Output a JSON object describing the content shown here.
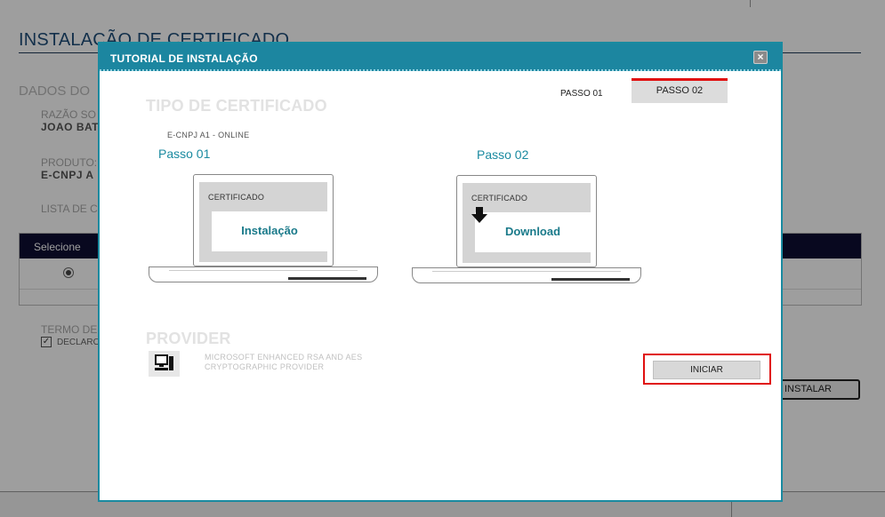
{
  "background": {
    "page_title": "INSTALAÇÃO DE  CERTIFICADO",
    "section_title": "DADOS DO",
    "fields": [
      {
        "label": "RAZÃO SO",
        "value": "JOAO BAT"
      },
      {
        "label": "PRODUTO:",
        "value": "E-CNPJ A"
      },
      {
        "label": "LISTA DE C",
        "value": ""
      }
    ],
    "table_header": "Selecione",
    "terms_label": "TERMO DE",
    "declare_label": "DECLARO",
    "install_button": "INSTALAR"
  },
  "modal": {
    "title": "TUTORIAL DE INSTALAÇÃO",
    "close_label": "×",
    "tabs": [
      {
        "label": "PASSO 01",
        "active": false
      },
      {
        "label": "PASSO 02",
        "active": true
      }
    ],
    "certificate_type_title": "TIPO DE CERTIFICADO",
    "certificate_type": "E-CNPJ A1 - ONLINE",
    "steps": [
      {
        "label": "Passo 01",
        "screen_label": "CERTIFICADO",
        "action": "Instalação",
        "icon": "none"
      },
      {
        "label": "Passo 02",
        "screen_label": "CERTIFICADO",
        "action": "Download",
        "icon": "down-arrow-icon"
      }
    ],
    "provider_title": "PROVIDER",
    "provider_icon": "computer-icon",
    "provider_name": "MICROSOFT ENHANCED RSA AND AES CRYPTOGRAPHIC PROVIDER",
    "start_button": "INICIAR"
  },
  "colors": {
    "modal_header": "#1c86a0",
    "accent_teal": "#1a8aa0",
    "highlight_red": "#e01010",
    "table_header": "#0d0d33"
  }
}
